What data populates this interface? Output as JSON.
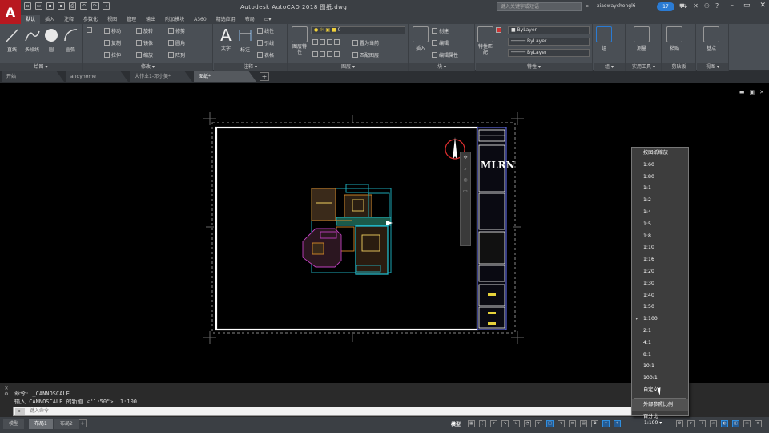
{
  "titlebar": {
    "logo": "A",
    "title": "Autodesk AutoCAD 2018    图纸.dwg",
    "search_placeholder": "键入关键字或短语",
    "user": "xiaowaychengl6",
    "badge_count": "17"
  },
  "ribbon_tabs": [
    "默认",
    "插入",
    "注释",
    "参数化",
    "视图",
    "管理",
    "输出",
    "附加模块",
    "A360",
    "精选应用",
    "布局"
  ],
  "ribbon": {
    "draw": {
      "line": "直线",
      "polyline": "多段线",
      "circle": "圆",
      "arc": "圆弧",
      "label": "绘图 ▾"
    },
    "modify": {
      "move": "移动",
      "rotate": "旋转",
      "trim": "修剪",
      "copy": "复制",
      "mirror": "镜像",
      "fillet": "圆角",
      "stretch": "拉伸",
      "scale": "缩放",
      "array": "阵列",
      "label": "修改 ▾"
    },
    "annotation": {
      "text": "文字",
      "dimension": "标注",
      "linear": "线性",
      "leader": "引线",
      "table": "表格",
      "label": "注释 ▾"
    },
    "layers": {
      "layer_props": "图层特性",
      "layer_value": "0",
      "set_current": "置为当前",
      "match_layer": "匹配图层",
      "label": "图层 ▾"
    },
    "block": {
      "insert": "插入",
      "create": "创建",
      "edit": "编辑",
      "edit_attr": "编辑属性",
      "label": "块 ▾"
    },
    "properties": {
      "match": "特性匹配",
      "bylayer1": "ByLayer",
      "bylayer2": "ByLayer",
      "bylayer3": "ByLayer",
      "label": "特性 ▾"
    },
    "groups": {
      "group": "组",
      "label": "组 ▾"
    },
    "utilities": {
      "measure": "测量",
      "label": "实用工具 ▾"
    },
    "clipboard": {
      "paste": "粘贴",
      "label": "剪贴板"
    },
    "view": {
      "base": "基点",
      "label": "视图 ▾"
    }
  },
  "doc_tabs": [
    "开始",
    "andyhome",
    "大作业1-邓小美*",
    "图纸*"
  ],
  "command": {
    "line1": "命令: _CANNOSCALE",
    "line2": "输入 CANNOSCALE 的新值 <\"1:50\">: 1:100",
    "input_placeholder": "键入命令"
  },
  "layout_tabs": [
    "模型",
    "布局1",
    "布局2"
  ],
  "status": {
    "model": "模型",
    "scale": "1:100 ▾"
  },
  "scale_menu": {
    "items": [
      "按图纸缩放",
      "1:60",
      "1:80",
      "1:1",
      "1:2",
      "1:4",
      "1:5",
      "1:8",
      "1:10",
      "1:16",
      "1:20",
      "1:30",
      "1:40",
      "1:50",
      "1:100",
      "2:1",
      "4:1",
      "8:1",
      "10:1",
      "100:1",
      "自定义..."
    ],
    "checked": "1:100",
    "extra": [
      "外部参照比例",
      "百分比"
    ]
  },
  "title_block": {
    "logo": "MLRN"
  },
  "colors": {
    "accent": "#2a7bd4",
    "brand": "#b8181f",
    "plan_cyan": "#21b8c8",
    "plan_orange": "#d88a2a",
    "plan_magenta": "#c040c0"
  }
}
